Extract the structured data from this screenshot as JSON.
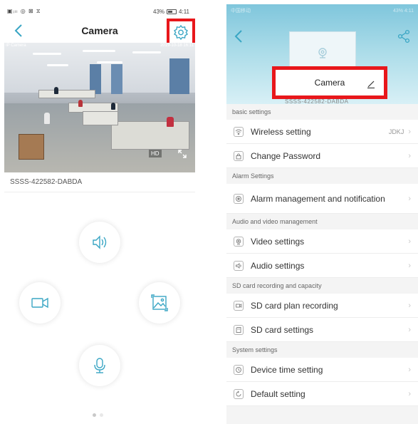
{
  "left": {
    "status": {
      "icons": "▣ᵢₗₗ ◎ ⊠ ⧖",
      "battery": "43%",
      "time": "4:11"
    },
    "nav": {
      "title": "Camera"
    },
    "video": {
      "cam_label": "IP Camera",
      "timestamp": "2019-10-18 16:11",
      "quality": "HD"
    },
    "device_id": "SSSS-422582-DABDA",
    "icons": [
      "back-arrow-icon",
      "gear-icon",
      "speaker-icon",
      "record-video-icon",
      "snapshot-icon",
      "microphone-icon",
      "fullscreen-icon"
    ],
    "page_dots": 2
  },
  "right": {
    "status": {
      "left": "中国移动",
      "right": "43% 4:11"
    },
    "camera_name": "Camera",
    "device_id_under": "SSSS-422582-DABDA",
    "sections": [
      {
        "title": "basic settings",
        "items": [
          {
            "label": "Wireless setting",
            "value": "JDKJ",
            "icon": "wifi-icon"
          },
          {
            "label": "Change Password",
            "value": "",
            "icon": "lock-icon"
          }
        ]
      },
      {
        "title": "Alarm Settings",
        "items": [
          {
            "label": "Alarm management and notification",
            "value": "",
            "icon": "alarm-icon"
          }
        ]
      },
      {
        "title": "Audio and video management",
        "items": [
          {
            "label": "Video settings",
            "value": "",
            "icon": "camera-icon"
          },
          {
            "label": "Audio settings",
            "value": "",
            "icon": "audio-icon"
          }
        ]
      },
      {
        "title": "SD card recording and capacity",
        "items": [
          {
            "label": "SD card plan recording",
            "value": "",
            "icon": "record-icon"
          },
          {
            "label": "SD card settings",
            "value": "",
            "icon": "sd-card-icon"
          }
        ]
      },
      {
        "title": "System settings",
        "items": [
          {
            "label": "Device time setting",
            "value": "",
            "icon": "clock-icon"
          },
          {
            "label": "Default setting",
            "value": "",
            "icon": "reset-icon"
          }
        ]
      }
    ],
    "chevron": "›"
  },
  "colors": {
    "highlight": "#e8171b",
    "accent": "#3aa6c4"
  }
}
